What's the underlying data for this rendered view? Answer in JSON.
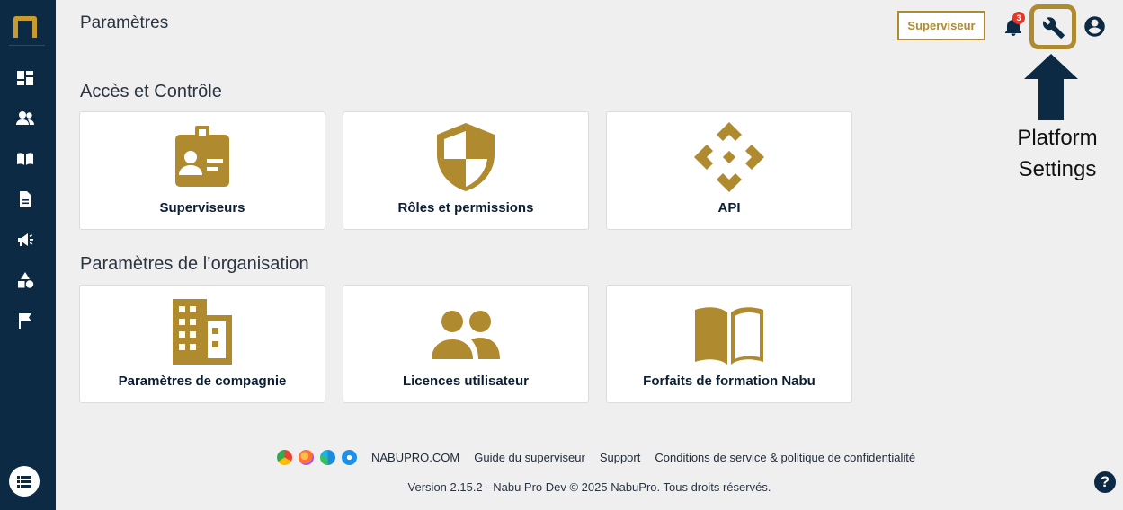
{
  "header": {
    "title": "Paramètres",
    "role_button": "Superviseur",
    "notification_count": "3"
  },
  "annotation": {
    "line1": "Platform",
    "line2": "Settings",
    "accent_color": "#b08a2e"
  },
  "sidebar": {
    "items": [
      {
        "icon": "dashboard-icon"
      },
      {
        "icon": "users-icon"
      },
      {
        "icon": "book-icon"
      },
      {
        "icon": "document-icon"
      },
      {
        "icon": "megaphone-icon"
      },
      {
        "icon": "shapes-icon"
      },
      {
        "icon": "flag-icon"
      }
    ],
    "menu_icon": "list-icon"
  },
  "sections": [
    {
      "title": "Accès et Contrôle",
      "cards": [
        {
          "label": "Superviseurs",
          "icon": "id-badge-icon"
        },
        {
          "label": "Rôles et permissions",
          "icon": "shield-icon"
        },
        {
          "label": "API",
          "icon": "api-diamond-icon"
        }
      ]
    },
    {
      "title": "Paramètres de l’organisation",
      "cards": [
        {
          "label": "Paramètres de compagnie",
          "icon": "building-icon"
        },
        {
          "label": "Licences utilisateur",
          "icon": "people-icon"
        },
        {
          "label": "Forfaits de formation Nabu",
          "icon": "open-book-icon"
        }
      ]
    }
  ],
  "footer": {
    "links": [
      "NABUPRO.COM",
      "Guide du superviseur",
      "Support",
      "Conditions de service & politique de confidentialité"
    ],
    "browsers": [
      "chrome-icon",
      "firefox-icon",
      "edge-icon",
      "safari-icon"
    ],
    "version": "Version 2.15.2 - Nabu Pro Dev © 2025 NabuPro. Tous droits réservés."
  },
  "help_label": "?"
}
